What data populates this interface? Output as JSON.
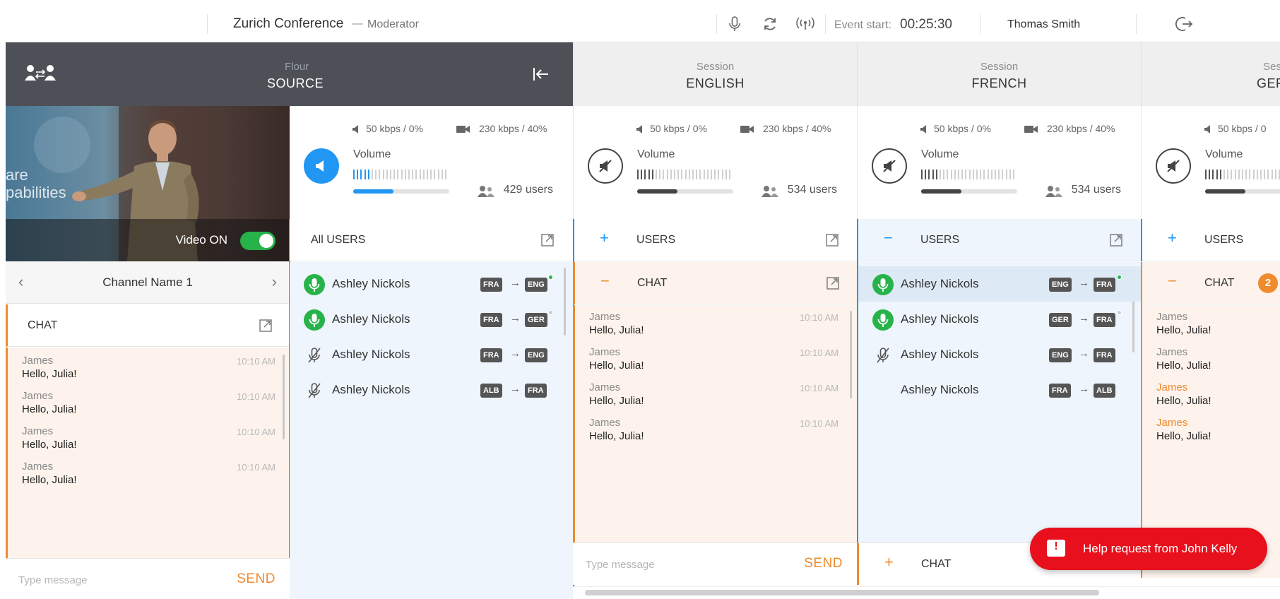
{
  "topbar": {
    "title": "Zurich Conference",
    "dash": "—",
    "role": "Moderator",
    "event_label": "Event start:",
    "event_time": "00:25:30",
    "user_name": "Thomas Smith"
  },
  "source": {
    "subtitle": "Flour",
    "title": "SOURCE",
    "video_label": "Video ON",
    "video_on": true,
    "channel_name": "Channel Name 1",
    "audio_rate": "50 kbps / 0%",
    "video_rate": "230 kbps / 40%",
    "volume_label": "Volume",
    "volume_level": 0.42,
    "users": "429 users",
    "users_label": "All USERS",
    "chat_label": "CHAT",
    "input_placeholder": "Type message",
    "send_label": "SEND",
    "chat": [
      {
        "name": "James",
        "text": "Hello, Julia!",
        "time": "10:10 AM"
      },
      {
        "name": "James",
        "text": "Hello, Julia!",
        "time": "10:10 AM"
      },
      {
        "name": "James",
        "text": "Hello, Julia!",
        "time": "10:10 AM"
      },
      {
        "name": "James",
        "text": "Hello, Julia!",
        "time": "10:10 AM"
      }
    ],
    "user_list": [
      {
        "name": "Ashley Nickols",
        "from": "FRA",
        "to": "ENG",
        "mic": "active",
        "status": "online"
      },
      {
        "name": "Ashley Nickols",
        "from": "FRA",
        "to": "GER",
        "mic": "active",
        "status": "away"
      },
      {
        "name": "Ashley Nickols",
        "from": "FRA",
        "to": "ENG",
        "mic": "muted",
        "status": ""
      },
      {
        "name": "Ashley Nickols",
        "from": "ALB",
        "to": "FRA",
        "mic": "muted",
        "status": ""
      }
    ]
  },
  "english": {
    "subtitle": "Session",
    "title": "ENGLISH",
    "audio_rate": "50 kbps / 0%",
    "video_rate": "230 kbps / 40%",
    "volume_label": "Volume",
    "volume_level": 0.42,
    "users": "534 users",
    "users_label": "USERS",
    "chat_label": "CHAT",
    "input_placeholder": "Type message",
    "send_label": "SEND",
    "chat": [
      {
        "name": "James",
        "text": "Hello, Julia!",
        "time": "10:10 AM"
      },
      {
        "name": "James",
        "text": "Hello, Julia!",
        "time": "10:10 AM"
      },
      {
        "name": "James",
        "text": "Hello, Julia!",
        "time": "10:10 AM"
      },
      {
        "name": "James",
        "text": "Hello, Julia!",
        "time": "10:10 AM"
      }
    ]
  },
  "french": {
    "subtitle": "Session",
    "title": "FRENCH",
    "audio_rate": "50 kbps / 0%",
    "video_rate": "230 kbps / 40%",
    "volume_label": "Volume",
    "volume_level": 0.42,
    "users": "534 users",
    "users_label": "USERS",
    "chat_label": "CHAT",
    "user_list": [
      {
        "name": "Ashley Nickols",
        "from": "ENG",
        "to": "FRA",
        "mic": "active",
        "status": "online"
      },
      {
        "name": "Ashley Nickols",
        "from": "GER",
        "to": "FRA",
        "mic": "active",
        "status": "away"
      },
      {
        "name": "Ashley Nickols",
        "from": "ENG",
        "to": "FRA",
        "mic": "muted",
        "status": ""
      },
      {
        "name": "Ashley Nickols",
        "from": "FRA",
        "to": "ALB",
        "mic": "none",
        "status": ""
      }
    ]
  },
  "german": {
    "subtitle": "Ses",
    "title": "GER",
    "audio_rate": "50 kbps / 0",
    "volume_label": "Volume",
    "volume_level": 0.42,
    "users_label": "USERS",
    "chat_label": "CHAT",
    "chat_badge": "2",
    "chat": [
      {
        "name": "James",
        "text": "Hello, Julia!",
        "highlight": false
      },
      {
        "name": "James",
        "text": "Hello, Julia!",
        "highlight": false
      },
      {
        "name": "James",
        "text": "Hello, Julia!",
        "highlight": true
      },
      {
        "name": "James",
        "text": "Hello, Julia!",
        "highlight": true
      }
    ]
  },
  "toast": {
    "text": "Help request from John Kelly"
  },
  "colors": {
    "accent_blue": "#2196f3",
    "accent_orange": "#f08a2c",
    "success_green": "#27b34a",
    "alert_red": "#e8101c",
    "header_dark": "#4e5057"
  },
  "icons": {
    "mic": "microphone-icon",
    "refresh": "refresh-icon",
    "broadcast": "broadcast-icon",
    "logout": "logout-icon",
    "swap_users": "swap-users-icon",
    "collapse": "collapse-left-icon",
    "external": "external-link-icon"
  }
}
